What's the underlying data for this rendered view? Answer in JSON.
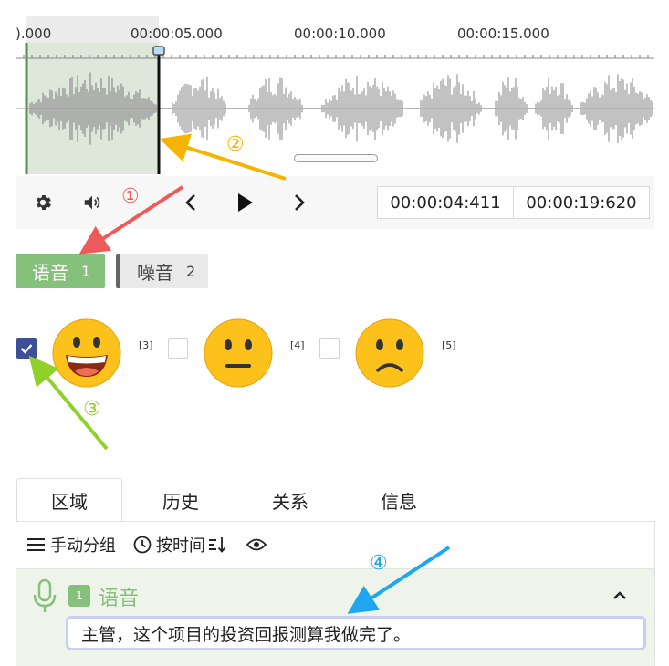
{
  "waveform": {
    "tick_labels": [
      ").000",
      "00:00:05.000",
      "00:00:10.000",
      "00:00:15.000"
    ]
  },
  "player": {
    "current_time": "00:00:04:411",
    "total_time": "00:00:19:620"
  },
  "labels": [
    {
      "name": "语音",
      "count": "1"
    },
    {
      "name": "噪音",
      "count": "2"
    }
  ],
  "emoji_options": {
    "hotkeys": [
      "[3]",
      "[4]",
      "[5]"
    ],
    "items": [
      "grinning-face",
      "neutral-face",
      "slightly-frowning-face"
    ],
    "first_checked": true
  },
  "panel": {
    "tabs": [
      "区域",
      "历史",
      "关系",
      "信息"
    ],
    "toolbar": {
      "group_label": "手动分组",
      "sort_label": "按时间"
    },
    "region": {
      "badge": "1",
      "label": "语音",
      "text": "主管，这个项目的投资回报测算我做完了。"
    }
  },
  "annotations": [
    "①",
    "②",
    "③",
    "④"
  ],
  "colors": {
    "voice_green": "#86c17b",
    "checkbox_blue": "#3d4f96",
    "arrow_red": "#ee5a5a",
    "arrow_yellow": "#f6b400",
    "arrow_green": "#8fd12a",
    "arrow_blue": "#1ea7f0"
  }
}
